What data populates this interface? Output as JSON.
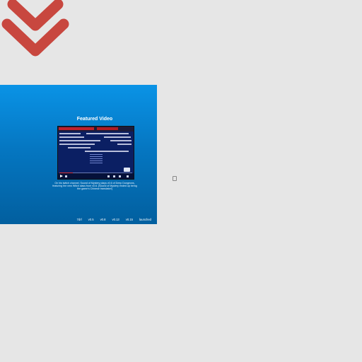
{
  "hero": {
    "title": "Featured Video",
    "caption": "On his twitch channel, Sound of Mystery plays v0.6 of Deep Dungeons, featuring the new Witch class from v0.6. [Sound of Mystery ended up being the game's Chinese translator!]",
    "versions": [
      "7drl",
      "v0.5",
      "v0.8",
      "v0.13",
      "v0.15",
      "launched"
    ]
  },
  "colors": {
    "logo": "#c8473f",
    "hero_top": "#0a93e6",
    "hero_bottom": "#025f9f",
    "background": "#e6e6e6"
  },
  "icons": {
    "logo": "double-chevron-down-icon"
  }
}
